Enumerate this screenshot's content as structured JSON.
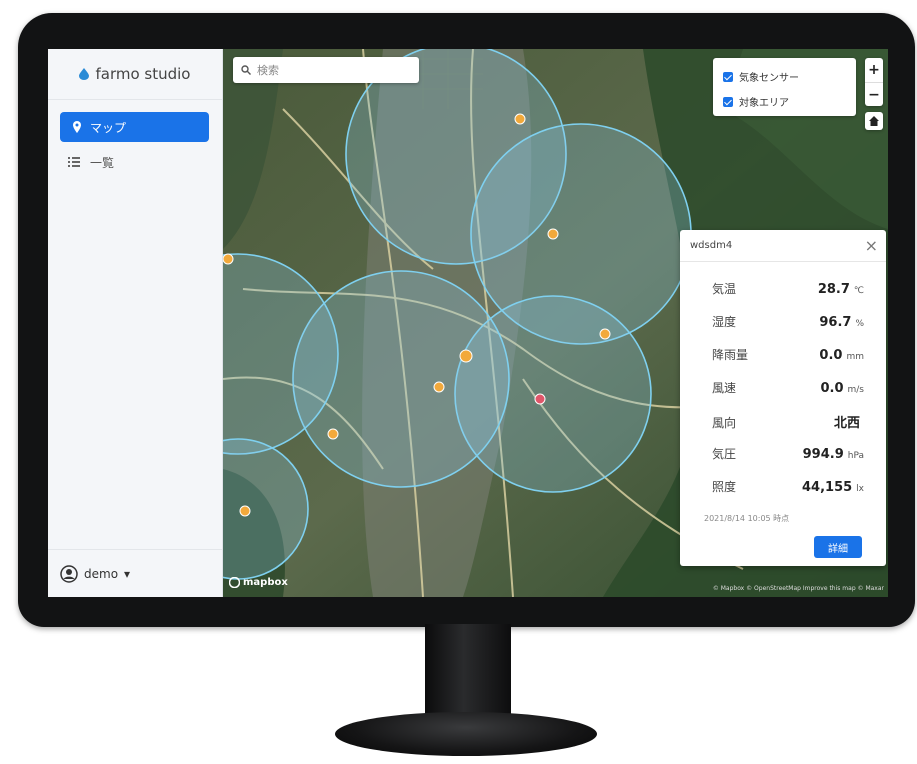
{
  "brand": {
    "name": "farmo studio",
    "accent": "#1a73e8"
  },
  "sidebar": {
    "active_item": {
      "label": "マップ",
      "icon": "map-pin-icon"
    },
    "list_item": {
      "label": "一覧",
      "icon": "list-icon"
    },
    "user": {
      "name": "demo",
      "caret": "▾"
    }
  },
  "search": {
    "placeholder": "検索",
    "icon": "search-icon"
  },
  "layers": [
    {
      "label": "気象センサー",
      "checked": true
    },
    {
      "label": "対象エリア",
      "checked": true
    }
  ],
  "zoom": {
    "in": "+",
    "out": "−"
  },
  "popup": {
    "title": "wdsdm4",
    "close": "×",
    "rows": [
      {
        "label": "気温",
        "value": "28.7",
        "unit": "℃"
      },
      {
        "label": "湿度",
        "value": "96.7",
        "unit": "%"
      },
      {
        "label": "降雨量",
        "value": "0.0",
        "unit": "mm"
      },
      {
        "label": "風速",
        "value": "0.0",
        "unit": "m/s"
      },
      {
        "label": "風向",
        "value": "北西",
        "unit": ""
      },
      {
        "label": "気圧",
        "value": "994.9",
        "unit": "hPa"
      },
      {
        "label": "照度",
        "value": "44,155",
        "unit": "lx"
      }
    ],
    "timestamp": "2021/8/14 10:05 時点",
    "detail_button": "詳細"
  },
  "map": {
    "logo": "mapbox",
    "attribution": "© Mapbox © OpenStreetMap Improve this map © Maxar"
  }
}
